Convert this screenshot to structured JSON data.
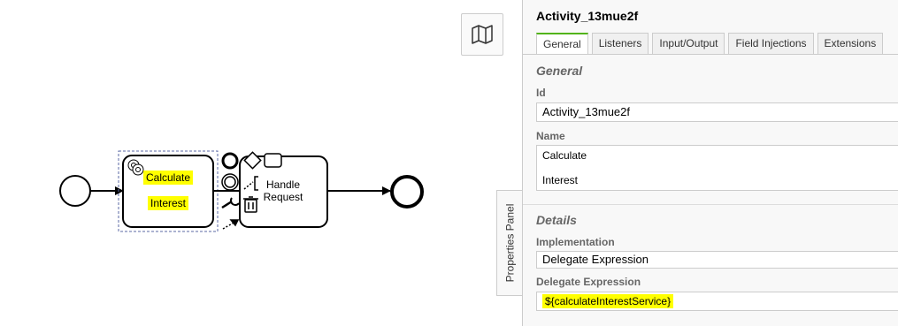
{
  "canvas": {
    "start_event": "start-event",
    "task_calculate": {
      "line1": "Calculate",
      "line2": "Interest"
    },
    "task_handle": {
      "line1": "Handle",
      "line2": "Request"
    },
    "end_event": "end-event"
  },
  "minimap_toggle": {
    "icon": "map-icon"
  },
  "panel_toggle": {
    "label": "Properties Panel"
  },
  "properties": {
    "element_name": "Activity_13mue2f",
    "tabs": [
      "General",
      "Listeners",
      "Input/Output",
      "Field Injections",
      "Extensions"
    ],
    "active_tab": "General",
    "general_group": "General",
    "id_label": "Id",
    "id_value": "Activity_13mue2f",
    "name_label": "Name",
    "name_line1": "Calculate",
    "name_line2": "Interest",
    "details_group": "Details",
    "implementation_label": "Implementation",
    "implementation_value": "Delegate Expression",
    "delegate_label": "Delegate Expression",
    "delegate_value": "${calculateInterestService}"
  },
  "colors": {
    "highlight": "#ffff00",
    "active_tab_accent": "#52b415"
  }
}
